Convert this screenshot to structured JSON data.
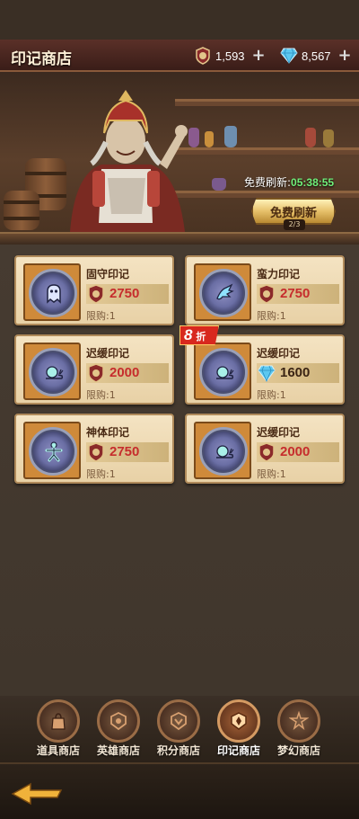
{
  "header": {
    "title": "印记商店",
    "currencies": [
      {
        "icon": "seal-coin-icon",
        "value": "1,593"
      },
      {
        "icon": "diamond-icon",
        "value": "8,567"
      }
    ]
  },
  "refresh": {
    "timer_label": "免费刷新:",
    "timer_value": "05:38:55",
    "button_label": "免费刷新",
    "count": "2/3"
  },
  "items": [
    {
      "name": "固守印记",
      "price": "2750",
      "currency": "seal",
      "limit": "限购:1",
      "glyph": "ghost-glyph-icon"
    },
    {
      "name": "蛮力印记",
      "price": "2750",
      "currency": "seal",
      "limit": "限购:1",
      "glyph": "claw-glyph-icon"
    },
    {
      "name": "迟缓印记",
      "price": "2000",
      "currency": "seal",
      "limit": "限购:1",
      "glyph": "snail-glyph-icon"
    },
    {
      "name": "迟缓印记",
      "price": "1600",
      "currency": "diamond",
      "limit": "限购:1",
      "glyph": "snail-glyph-icon",
      "discount": "8",
      "discount_unit": "折"
    },
    {
      "name": "神体印记",
      "price": "2750",
      "currency": "seal",
      "limit": "限购:1",
      "glyph": "figure-glyph-icon"
    },
    {
      "name": "迟缓印记",
      "price": "2000",
      "currency": "seal",
      "limit": "限购:1",
      "glyph": "snail-glyph-icon"
    }
  ],
  "tabs": [
    {
      "label": "道具商店",
      "icon": "bag-icon",
      "active": false
    },
    {
      "label": "英雄商店",
      "icon": "hero-emblem-icon",
      "active": false
    },
    {
      "label": "积分商店",
      "icon": "chevron-emblem-icon",
      "active": false
    },
    {
      "label": "印记商店",
      "icon": "seal-emblem-icon",
      "active": true
    },
    {
      "label": "梦幻商店",
      "icon": "dream-emblem-icon",
      "active": false
    }
  ],
  "colors": {
    "price_red": "#c62d2d",
    "card_bg": "#f4e3c2",
    "timer_green": "#6ff07a",
    "discount_red": "#d8281e"
  }
}
